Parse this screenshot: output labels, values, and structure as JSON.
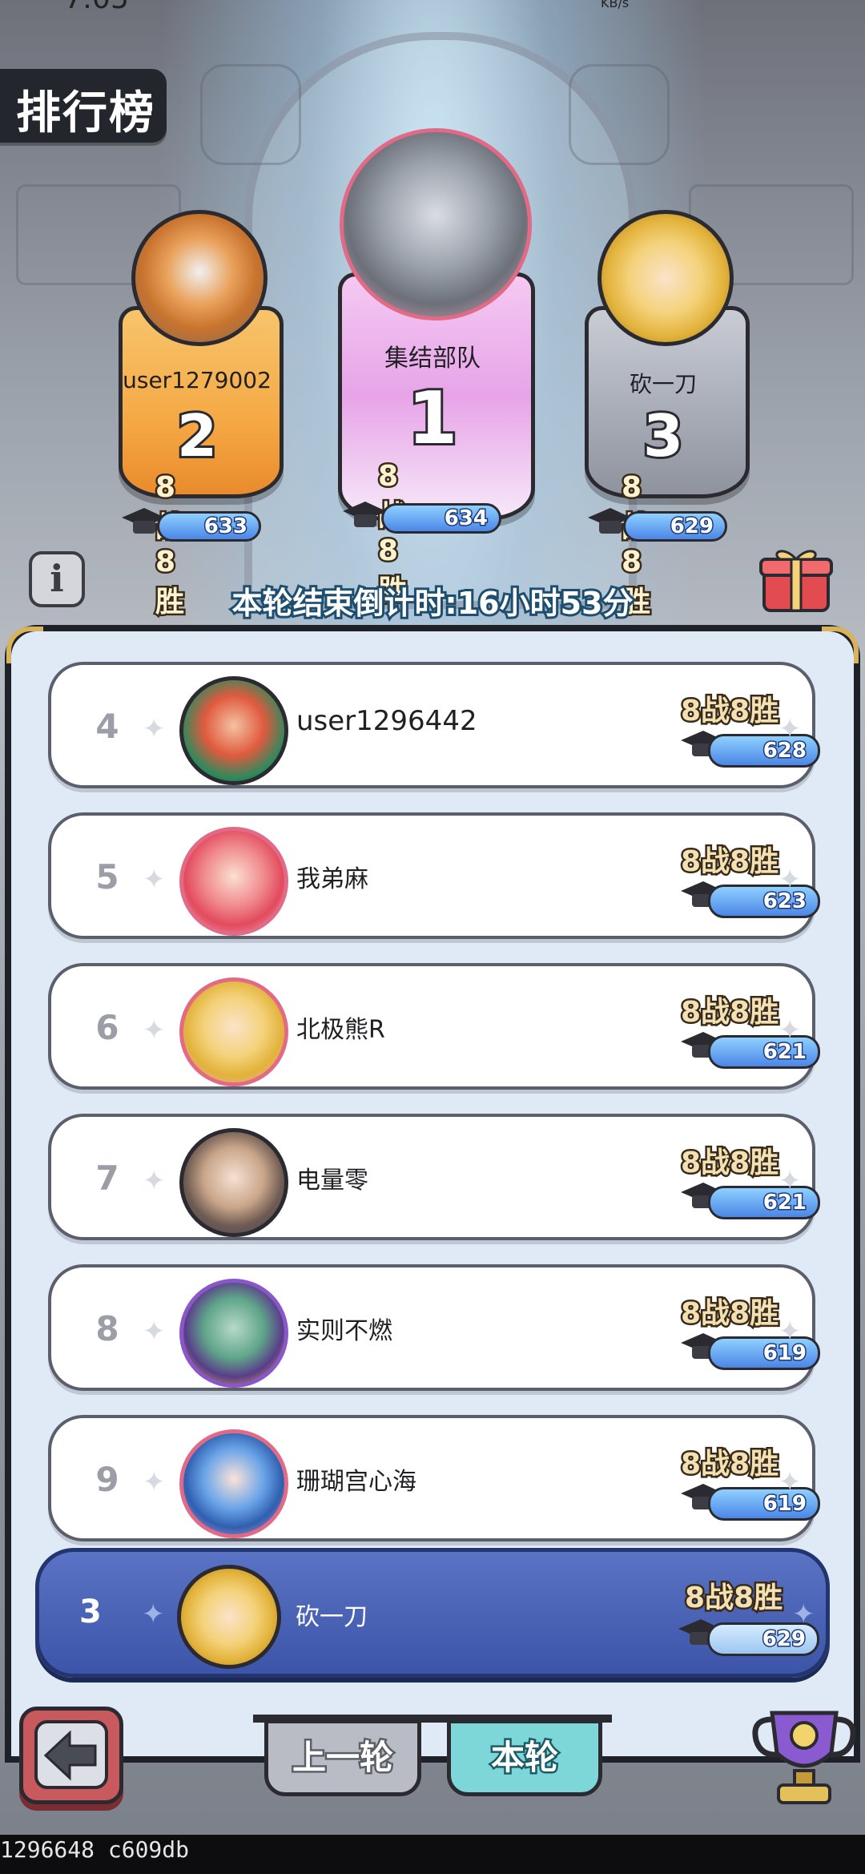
{
  "status": {
    "time": "7:05",
    "net": "KB/s"
  },
  "header": {
    "title": "排行榜"
  },
  "podium": [
    {
      "rank": "2",
      "name": "user1279002",
      "record": "8战8胜",
      "score": "633"
    },
    {
      "rank": "1",
      "name": "集结部队",
      "record": "8战8胜",
      "score": "634"
    },
    {
      "rank": "3",
      "name": "砍一刀",
      "record": "8战8胜",
      "score": "629"
    }
  ],
  "countdown": "本轮结束倒计时:16小时53分",
  "list": [
    {
      "rank": "4",
      "name": "user1296442",
      "record": "8战8胜",
      "score": "628"
    },
    {
      "rank": "5",
      "name": "我弟麻",
      "record": "8战8胜",
      "score": "623"
    },
    {
      "rank": "6",
      "name": "北极熊R",
      "record": "8战8胜",
      "score": "621"
    },
    {
      "rank": "7",
      "name": "电量零",
      "record": "8战8胜",
      "score": "621"
    },
    {
      "rank": "8",
      "name": "实则不燃",
      "record": "8战8胜",
      "score": "619"
    },
    {
      "rank": "9",
      "name": "珊瑚宫心海",
      "record": "8战8胜",
      "score": "619"
    }
  ],
  "me": {
    "rank": "3",
    "name": "砍一刀",
    "record": "8战8胜",
    "score": "629"
  },
  "tabs": {
    "prev": "上一轮",
    "current": "本轮"
  },
  "footer": {
    "build": "1296648 c609db"
  },
  "colors": {
    "accent": "#3c55a8",
    "gold": "#f5a945",
    "pink": "#e7a4e8",
    "silver": "#a8adb8"
  }
}
